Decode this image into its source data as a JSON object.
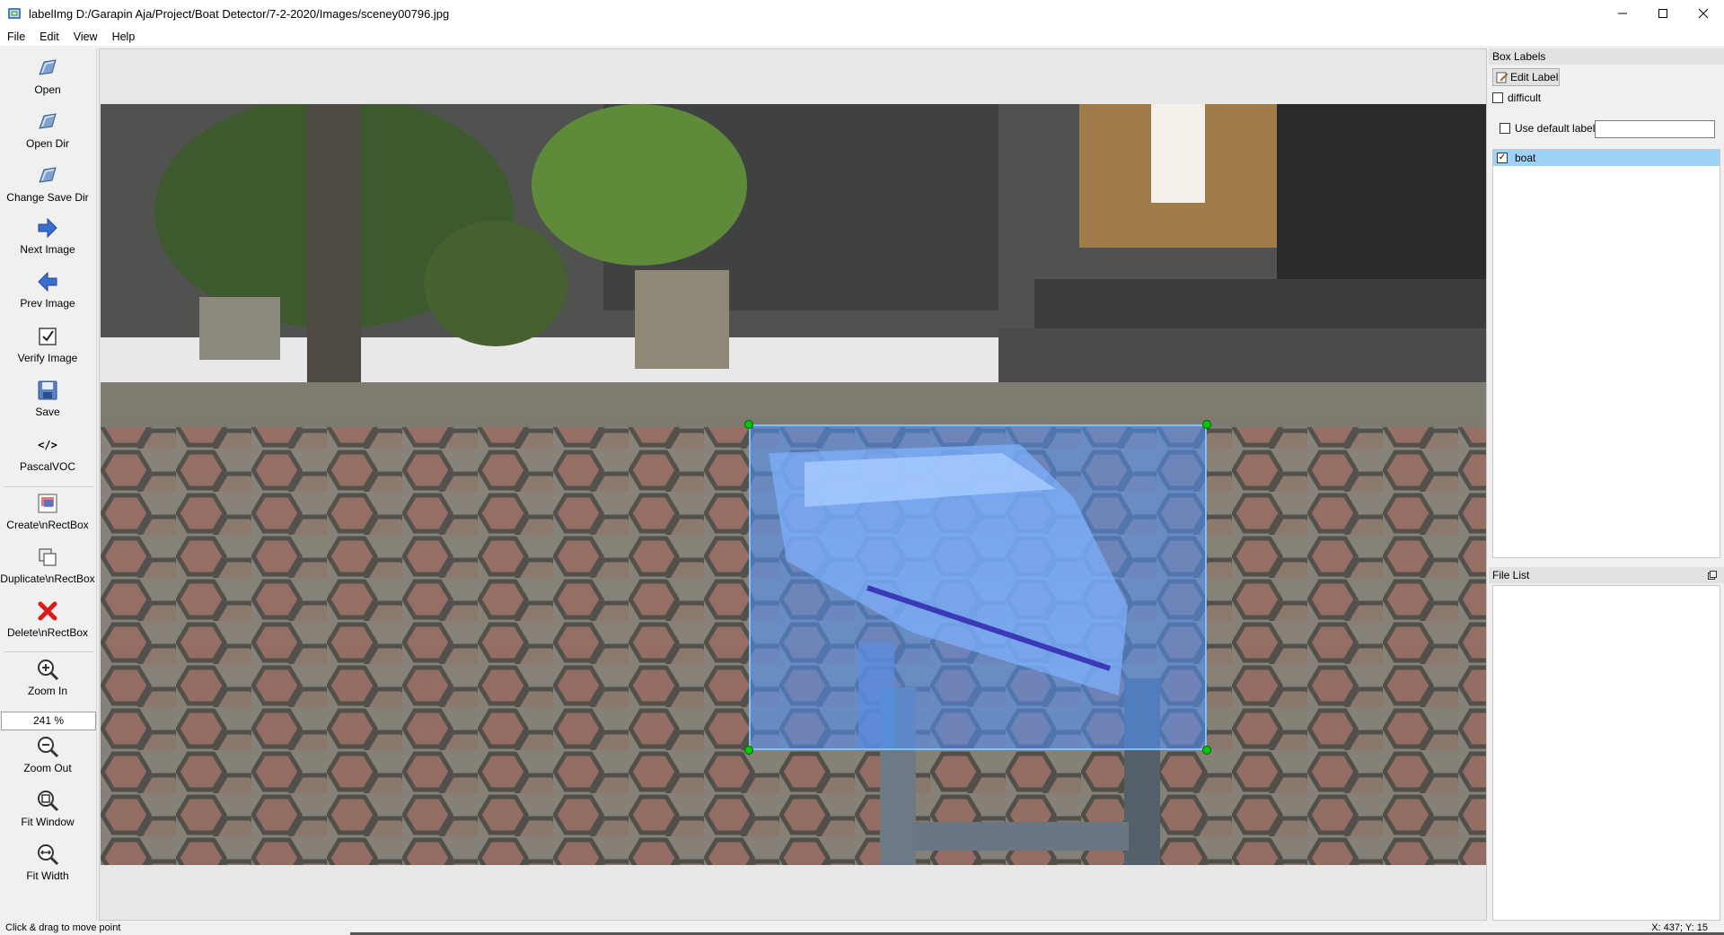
{
  "window": {
    "title": "labelImg D:/Garapin Aja/Project/Boat Detector/7-2-2020/Images/sceney00796.jpg",
    "app_icon": "labelimg-icon",
    "controls": [
      "minimize-icon",
      "maximize-icon",
      "close-icon"
    ]
  },
  "menu": {
    "items": [
      "File",
      "Edit",
      "View",
      "Help"
    ]
  },
  "toolbar": {
    "open": "Open",
    "open_dir": "Open Dir",
    "change_save_dir": "Change Save Dir",
    "next_image": "Next Image",
    "prev_image": "Prev Image",
    "verify_image": "Verify Image",
    "save": "Save",
    "format_icon_text": "</>",
    "format": "PascalVOC",
    "create_rectbox": "Create\\nRectBox",
    "duplicate_rectbox": "Duplicate\\nRectBox",
    "delete_rectbox": "Delete\\nRectBox",
    "zoom_in": "Zoom In",
    "zoom_value": "241 %",
    "zoom_out": "Zoom Out",
    "fit_window": "Fit Window",
    "fit_width": "Fit Width"
  },
  "colors": {
    "bbox_fill": "#5096ff",
    "bbox_border": "#7fbfff",
    "handle": "#00c800",
    "selected_label": "#9ed3f7",
    "delete_icon": "#e01818",
    "arrow_icon": "#3a6fd0"
  },
  "box_labels": {
    "title": "Box Labels",
    "edit_label_button": "Edit Label",
    "difficult": "difficult",
    "difficult_checked": false,
    "use_default_label": "Use default label",
    "use_default_label_checked": false,
    "default_label_value": "",
    "labels": [
      {
        "name": "boat",
        "checked": true,
        "selected": true
      }
    ]
  },
  "file_list": {
    "title": "File List",
    "files": []
  },
  "status": {
    "message": "Click & drag to move point",
    "coords": "X: 437; Y: 15"
  }
}
